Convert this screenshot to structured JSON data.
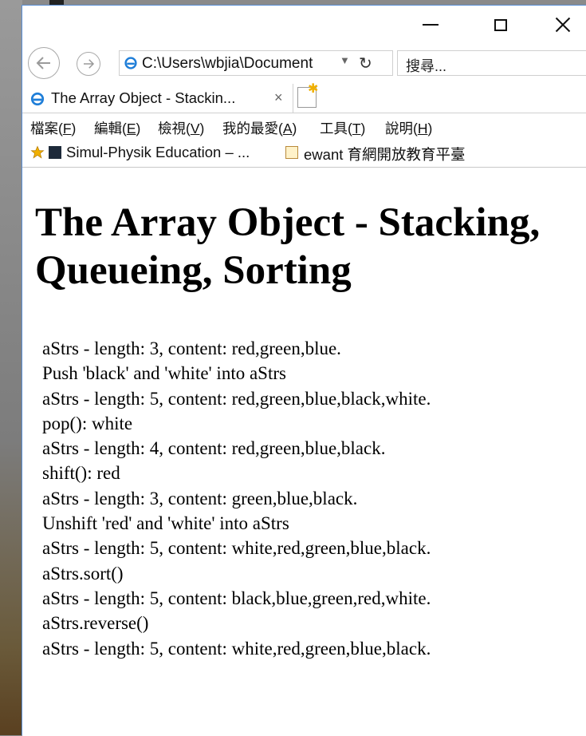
{
  "browser": {
    "address": "C:\\Users\\wbjia\\Document",
    "search_placeholder": "搜尋...",
    "tab_title": "The Array Object - Stackin...",
    "tab_close": "×",
    "menu": [
      {
        "text": "檔案(",
        "key": "F",
        "end": ")"
      },
      {
        "text": "編輯(",
        "key": "E",
        "end": ")"
      },
      {
        "text": "檢視(",
        "key": "V",
        "end": ")"
      },
      {
        "text": "我的最愛(",
        "key": "A",
        "end": ")"
      },
      {
        "text": "工具(",
        "key": "T",
        "end": ")"
      },
      {
        "text": "說明(",
        "key": "H",
        "end": ")"
      }
    ],
    "favorites": [
      "Simul-Physik Education – ...",
      "ewant 育網開放教育平臺"
    ]
  },
  "page": {
    "title": "The Array Object - Stacking, Queueing, Sorting",
    "lines": [
      "aStrs - length: 3, content: red,green,blue.",
      "Push 'black' and 'white' into aStrs",
      "aStrs - length: 5, content: red,green,blue,black,white.",
      "pop(): white",
      "aStrs - length: 4, content: red,green,blue,black.",
      "shift(): red",
      "aStrs - length: 3, content: green,blue,black.",
      "Unshift 'red' and 'white' into aStrs",
      "aStrs - length: 5, content: white,red,green,blue,black.",
      "aStrs.sort()",
      "aStrs - length: 5, content: black,blue,green,red,white.",
      "aStrs.reverse()",
      "aStrs - length: 5, content: white,red,green,blue,black."
    ]
  },
  "icons": {
    "browser": "internet-explorer-icon",
    "back": "back-arrow-icon",
    "forward": "forward-arrow-icon",
    "refresh": "refresh-icon",
    "favorite": "star-icon"
  },
  "colors": {
    "window_border": "#5a8fd6",
    "ie_blue": "#1f7ed8",
    "favorites_star": "#f0b000"
  }
}
